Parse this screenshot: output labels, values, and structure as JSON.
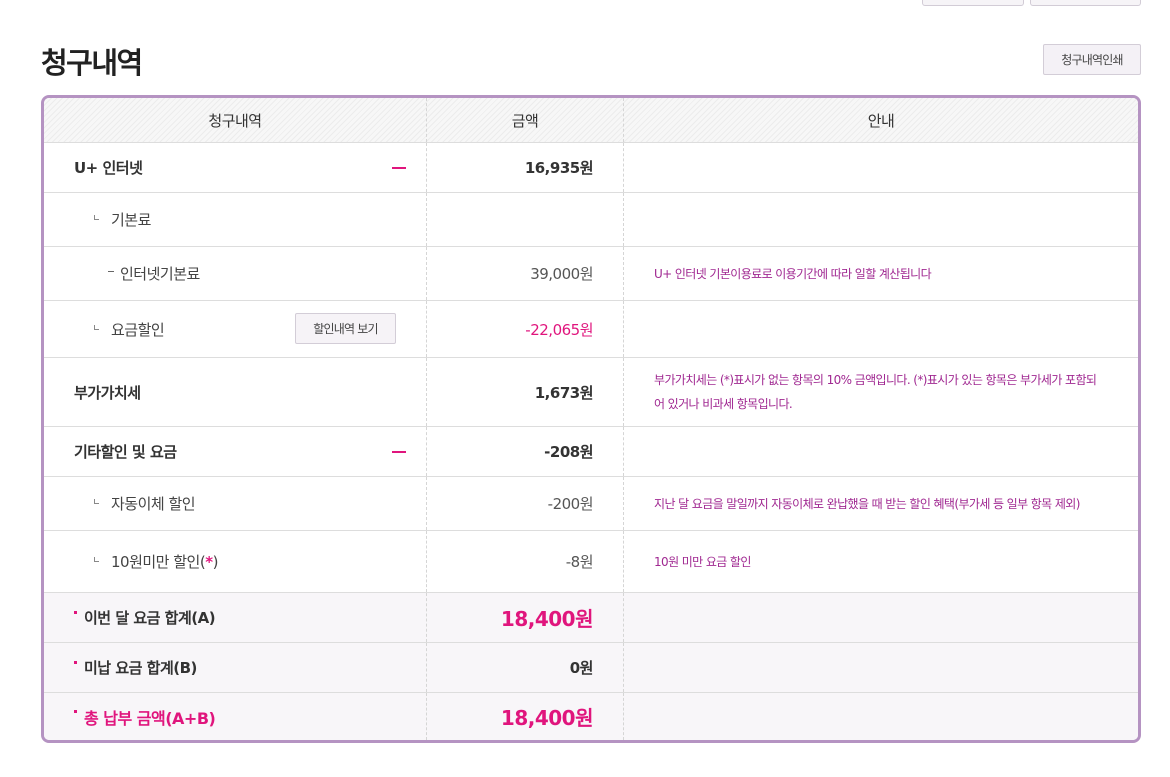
{
  "page_title": "청구내역",
  "print_button": "청구내역인쇄",
  "table": {
    "headers": [
      "청구내역",
      "금액",
      "안내"
    ],
    "internet": {
      "label": "U+ 인터넷",
      "amount": "16,935원"
    },
    "basic_fee": {
      "label": "기본료"
    },
    "internet_basic": {
      "label": "인터넷기본료",
      "amount": "39,000원",
      "note": "U+ 인터넷 기본이용료로 이용기간에 따라 일할 계산됩니다"
    },
    "discount": {
      "label": "요금할인",
      "button": "할인내역 보기",
      "amount": "-22,065원"
    },
    "vat": {
      "label": "부가가치세",
      "amount": "1,673원",
      "note": "부가가치세는 (*)표시가 없는 항목의 10% 금액입니다. (*)표시가 있는 항목은 부가세가 포함되어 있거나 비과세 항목입니다."
    },
    "other": {
      "label": "기타할인 및 요금",
      "amount": "-208원"
    },
    "autopay": {
      "label": "자동이체 할인",
      "amount": "-200원",
      "note": "지난 달 요금을 말일까지 자동이체로 완납했을 때 받는 할인 혜택(부가세 등 일부 항목 제외)"
    },
    "under10": {
      "label": "10원미만 할인(",
      "star": "*",
      "close": ")",
      "amount": "-8원",
      "note": "10원 미만 요금 할인"
    },
    "month_total": {
      "label": "이번 달 요금 합계(A)",
      "amount": "18,400원"
    },
    "unpaid_total": {
      "label": "미납 요금 합계(B)",
      "amount": "0원"
    },
    "grand_total": {
      "label": "총 납부 금액(A+B)",
      "amount": "18,400원"
    }
  }
}
